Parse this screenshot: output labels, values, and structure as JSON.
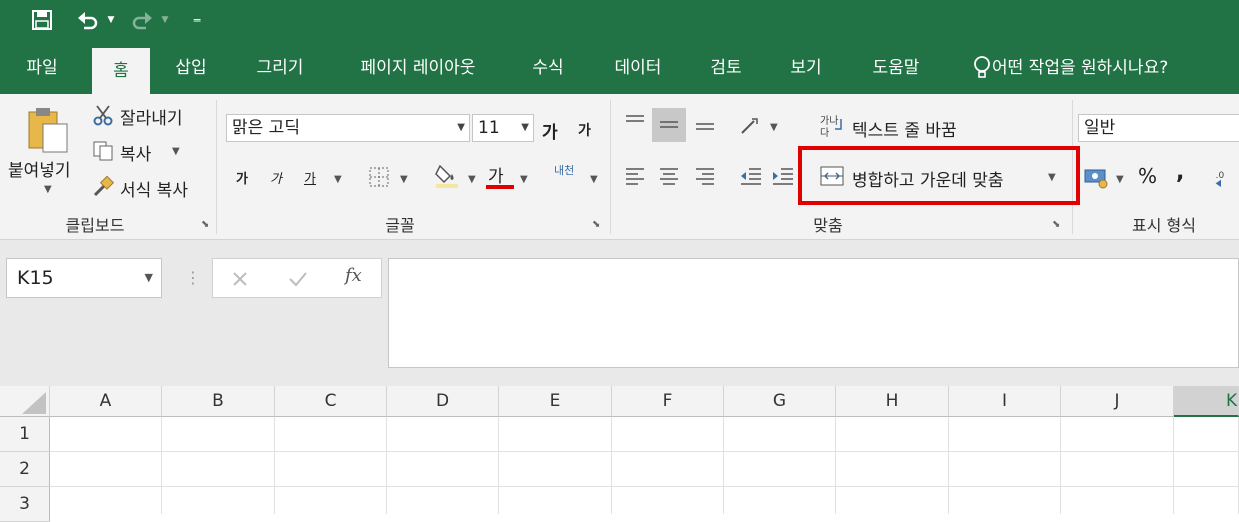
{
  "quick_access": {
    "save": "save-icon",
    "undo": "undo-icon",
    "redo": "redo-icon",
    "customize": "customize-icon"
  },
  "tabs": [
    "파일",
    "홈",
    "삽입",
    "그리기",
    "페이지 레이아웃",
    "수식",
    "데이터",
    "검토",
    "보기",
    "도움말"
  ],
  "tell_me": "어떤 작업을 원하시나요?",
  "clipboard": {
    "paste": "붙여넣기",
    "cut": "잘라내기",
    "copy": "복사",
    "format_painter": "서식 복사",
    "label": "클립보드"
  },
  "font": {
    "name": "맑은 고딕",
    "size": "11",
    "grow": "가",
    "shrink": "가",
    "bold": "가",
    "italic": "가",
    "underline": "가",
    "font_color_glyph": "가",
    "phonetic": "내천",
    "label": "글꼴"
  },
  "alignment": {
    "wrap_text": "텍스트 줄 바꿈",
    "merge_center": "병합하고 가운데 맞춤",
    "label": "맞춤"
  },
  "number": {
    "format": "일반",
    "percent": "%",
    "comma": ",",
    "label": "표시 형식"
  },
  "formula_bar": {
    "name_box": "K15",
    "fx": "fx",
    "formula": ""
  },
  "columns": [
    "A",
    "B",
    "C",
    "D",
    "E",
    "F",
    "G",
    "H",
    "I",
    "J",
    "K"
  ],
  "rows": [
    "1",
    "2",
    "3"
  ],
  "colors": {
    "excel_green": "#217346",
    "highlight": "#e00000",
    "font_color_bar": "#e00000"
  }
}
